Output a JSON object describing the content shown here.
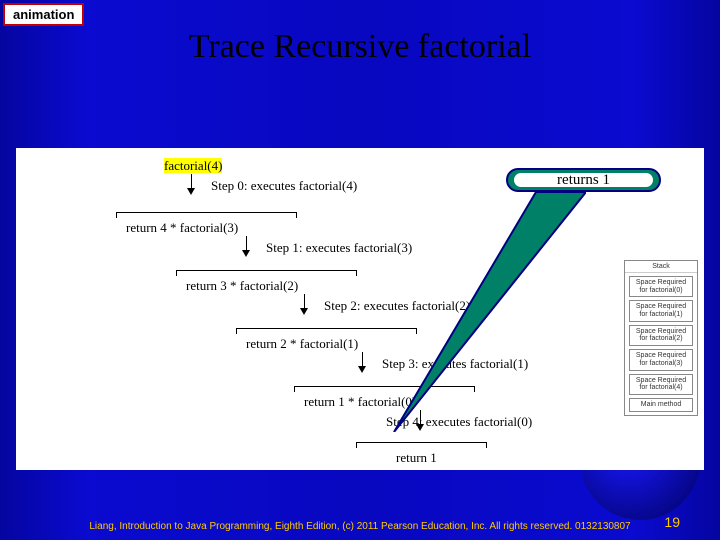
{
  "tag": "animation",
  "title": "Trace Recursive factorial",
  "callout": "returns 1",
  "diagram": {
    "start": "factorial(4)",
    "steps": [
      {
        "label": "Step 0: executes factorial(4)",
        "ret": "return 4 * factorial(3)"
      },
      {
        "label": "Step 1: executes factorial(3)",
        "ret": "return 3 * factorial(2)"
      },
      {
        "label": "Step 2: executes factorial(2)",
        "ret": "return 2 * factorial(1)"
      },
      {
        "label": "Step 3: executes factorial(1)",
        "ret": "return 1 * factorial(0)"
      },
      {
        "label": "Step 4: executes factorial(0)",
        "ret": "return 1"
      }
    ]
  },
  "stack": {
    "title": "Stack",
    "frames": [
      "Space Required for factorial(0)",
      "Space Required for factorial(1)",
      "Space Required for factorial(2)",
      "Space Required for factorial(3)",
      "Space Required for factorial(4)",
      "Main method"
    ]
  },
  "footer": "Liang, Introduction to Java Programming, Eighth Edition, (c) 2011 Pearson Education, Inc. All rights reserved. 0132130807",
  "page": "19"
}
